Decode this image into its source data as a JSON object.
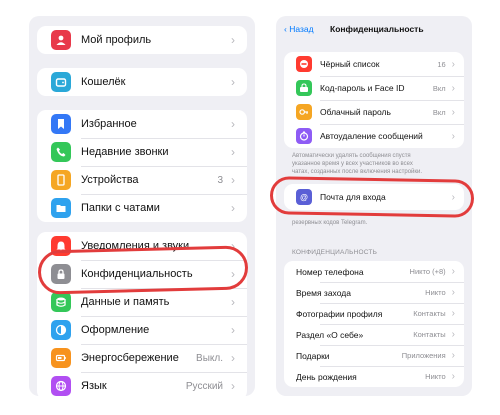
{
  "left": {
    "groups": [
      [
        {
          "icon": "user-icon",
          "color": "#e8394a",
          "label": "Мой профиль",
          "value": ""
        }
      ],
      [
        {
          "icon": "wallet-icon",
          "color": "#2aa8d8",
          "label": "Кошелёк",
          "value": ""
        }
      ],
      [
        {
          "icon": "bookmark-icon",
          "color": "#3478f6",
          "label": "Избранное",
          "value": ""
        },
        {
          "icon": "phone-icon",
          "color": "#34c759",
          "label": "Недавние звонки",
          "value": ""
        },
        {
          "icon": "devices-icon",
          "color": "#f5a623",
          "label": "Устройства",
          "value": "3"
        },
        {
          "icon": "folder-icon",
          "color": "#2fa2ee",
          "label": "Папки с чатами",
          "value": ""
        }
      ],
      [
        {
          "icon": "bell-icon",
          "color": "#ff3b30",
          "label": "Уведомления и звуки",
          "value": ""
        },
        {
          "icon": "lock-icon",
          "color": "#8e8e93",
          "label": "Конфиденциальность",
          "value": ""
        },
        {
          "icon": "database-icon",
          "color": "#34c759",
          "label": "Данные и память",
          "value": ""
        },
        {
          "icon": "appearance-icon",
          "color": "#2fa2ee",
          "label": "Оформление",
          "value": ""
        },
        {
          "icon": "battery-icon",
          "color": "#f7931e",
          "label": "Энергосбережение",
          "value": "Выкл."
        },
        {
          "icon": "globe-icon",
          "color": "#b14ff2",
          "label": "Язык",
          "value": "Русский"
        }
      ]
    ]
  },
  "right": {
    "back_label": "Назад",
    "title": "Конфиденциальность",
    "security_items": [
      {
        "icon": "block-icon",
        "color": "#ff3b30",
        "label": "Чёрный список",
        "value": "16"
      },
      {
        "icon": "faceid-icon",
        "color": "#34c759",
        "label": "Код-пароль и Face ID",
        "value": "Вкл"
      },
      {
        "icon": "key-icon",
        "color": "#f5a623",
        "label": "Облачный пароль",
        "value": "Вкл"
      },
      {
        "icon": "timer-icon",
        "color": "#8e5cf5",
        "label": "Автоудаление сообщений",
        "value": ""
      }
    ],
    "autodelete_note_lines": [
      "Автоматически удалять сообщения спустя",
      "указанное время у всех участников во всех",
      "чатах, созданных после включения настройки."
    ],
    "login_email": {
      "icon": "at-icon",
      "color": "#5a5fd6",
      "label": "Почта для входа",
      "value": ""
    },
    "login_note": "резервных кодов Telegram.",
    "privacy_header": "КОНФИДЕНЦИАЛЬНОСТЬ",
    "privacy_items": [
      {
        "label": "Номер телефона",
        "value": "Никто (+8)"
      },
      {
        "label": "Время захода",
        "value": "Никто"
      },
      {
        "label": "Фотографии профиля",
        "value": "Контакты"
      },
      {
        "label": "Раздел «О себе»",
        "value": "Контакты"
      },
      {
        "label": "Подарки",
        "value": "Приложения"
      },
      {
        "label": "День рождения",
        "value": "Никто"
      }
    ]
  },
  "highlight_color": "#e23c3c"
}
